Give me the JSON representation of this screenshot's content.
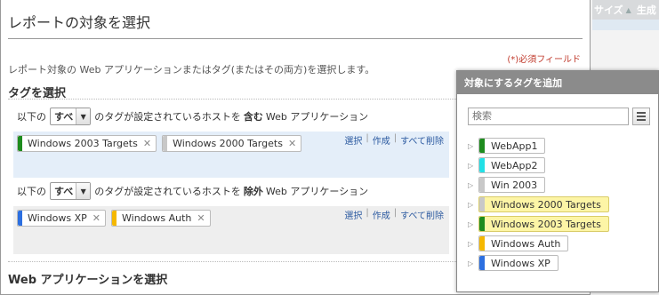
{
  "header_bg": {
    "col1": "サイズ",
    "col2": "生成"
  },
  "title": "レポートの対象を選択",
  "required_note": "(*)必須フィールド",
  "description": "レポート対象の Web アプリケーションまたはタグ(またはその両方)を選択します。",
  "tag_section_title": "タグを選択",
  "include": {
    "prefix": "以下の",
    "select_value": "すべ",
    "middle": "のタグが設定されているホストを",
    "keyword": "含む",
    "suffix": "Web アプリケーション",
    "tags": [
      {
        "label": "Windows 2003 Targets",
        "color": "#1e8c1e"
      },
      {
        "label": "Windows 2000 Targets",
        "color": "#c8c8c8"
      }
    ],
    "actions": {
      "select": "選択",
      "create": "作成",
      "delete_all": "すべて削除"
    }
  },
  "exclude": {
    "prefix": "以下の",
    "select_value": "すべ",
    "middle": "のタグが設定されているホストを",
    "keyword": "除外",
    "suffix": "Web アプリケーション",
    "tags": [
      {
        "label": "Windows XP",
        "color": "#2c6fe0"
      },
      {
        "label": "Windows Auth",
        "color": "#f5b800"
      }
    ],
    "actions": {
      "select": "選択",
      "create": "作成",
      "delete_all": "すべて削除"
    }
  },
  "webapp_section_title": "Web アプリケーションを選択",
  "popup": {
    "title": "対象にするタグを追加",
    "search_placeholder": "検索",
    "tags": [
      {
        "label": "WebApp1",
        "color": "#1e8c1e",
        "selected": false
      },
      {
        "label": "WebApp2",
        "color": "#22e0e6",
        "selected": false
      },
      {
        "label": "Win 2003",
        "color": "#c8c8c8",
        "selected": false
      },
      {
        "label": "Windows 2000 Targets",
        "color": "#c8c8c8",
        "selected": true
      },
      {
        "label": "Windows 2003 Targets",
        "color": "#1e8c1e",
        "selected": true
      },
      {
        "label": "Windows Auth",
        "color": "#f5b800",
        "selected": false
      },
      {
        "label": "Windows XP",
        "color": "#2c6fe0",
        "selected": false
      }
    ]
  }
}
